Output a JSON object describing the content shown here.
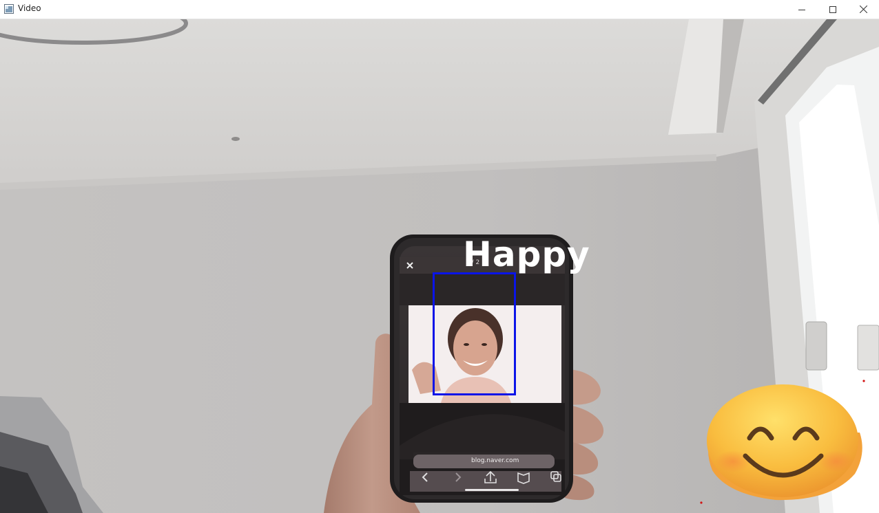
{
  "window": {
    "title": "Video",
    "icons": {
      "app": "window-app-icon",
      "minimize": "minimize-icon",
      "maximize": "maximize-icon",
      "close": "close-icon"
    }
  },
  "detection": {
    "emotion_label": "Happy",
    "face_box_color": "#0a14e8",
    "emoji": "smiling-face-emoji"
  },
  "phone_screen": {
    "counter": "7 / 2",
    "url": "blog.naver.com"
  },
  "colors": {
    "label_text": "#ffffff",
    "wall": "#c3c1c0",
    "ceiling": "#d9d8d6"
  }
}
